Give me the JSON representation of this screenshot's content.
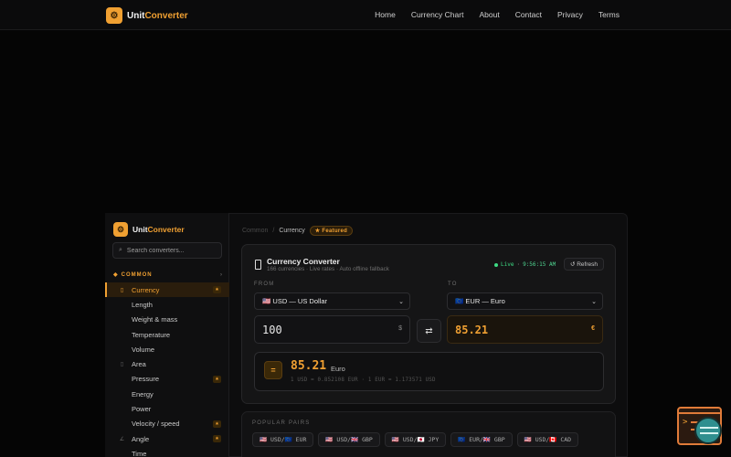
{
  "brand": {
    "icon": "gear-icon",
    "name_prefix": "Unit",
    "name_suffix": "Converter"
  },
  "nav": [
    "Home",
    "Currency Chart",
    "About",
    "Contact",
    "Privacy",
    "Terms"
  ],
  "sidebar": {
    "search_placeholder": "Search converters...",
    "section": "COMMON",
    "items": [
      {
        "label": "Currency",
        "active": true,
        "star": true,
        "icon": "file-icon"
      },
      {
        "label": "Length",
        "star": false,
        "icon": "ruler-icon"
      },
      {
        "label": "Weight & mass",
        "star": false,
        "icon": "weight-icon"
      },
      {
        "label": "Temperature",
        "star": false,
        "icon": "thermometer-icon"
      },
      {
        "label": "Volume",
        "star": false,
        "icon": "volume-icon"
      },
      {
        "label": "Area",
        "star": false,
        "icon": "area-icon"
      },
      {
        "label": "Pressure",
        "star": true,
        "icon": "pressure-icon"
      },
      {
        "label": "Energy",
        "star": false,
        "icon": "energy-icon"
      },
      {
        "label": "Power",
        "star": false,
        "icon": "power-icon"
      },
      {
        "label": "Velocity / speed",
        "star": true,
        "icon": "speed-icon"
      },
      {
        "label": "Angle",
        "star": true,
        "icon": "angle-icon"
      },
      {
        "label": "Time",
        "star": false,
        "icon": "clock-icon"
      }
    ]
  },
  "breadcrumb": {
    "root": "Common",
    "separator": "/",
    "current": "Currency",
    "badge": "★ Featured"
  },
  "converter": {
    "title": "Currency Converter",
    "subtitle": "166 currencies · Live rates · Auto offline fallback",
    "live_label": "Live",
    "time": "9:56:15 AM",
    "refresh_label": "↺ Refresh",
    "from_label": "FROM",
    "to_label": "TO",
    "from_currency": "🇺🇸 USD — US Dollar",
    "to_currency": "🇪🇺 EUR — Euro",
    "from_amount": "100",
    "from_symbol": "$",
    "to_amount": "85.21",
    "to_symbol": "€",
    "swap_label": "⇄",
    "result_symbol": "=",
    "result_value": "85.21",
    "result_currency": "Euro",
    "rate_text": "1 USD = 0.852108 EUR · 1 EUR = 1.173571 USD"
  },
  "popular": {
    "heading": "POPULAR PAIRS",
    "pairs": [
      "🇺🇸 USD/🇪🇺 EUR",
      "🇺🇸 USD/🇬🇧 GBP",
      "🇺🇸 USD/🇯🇵 JPY",
      "🇪🇺 EUR/🇬🇧 GBP",
      "🇺🇸 USD/🇨🇦 CAD"
    ]
  },
  "colors": {
    "accent": "#f0a032",
    "live": "#3ddc84",
    "background": "#050505"
  }
}
